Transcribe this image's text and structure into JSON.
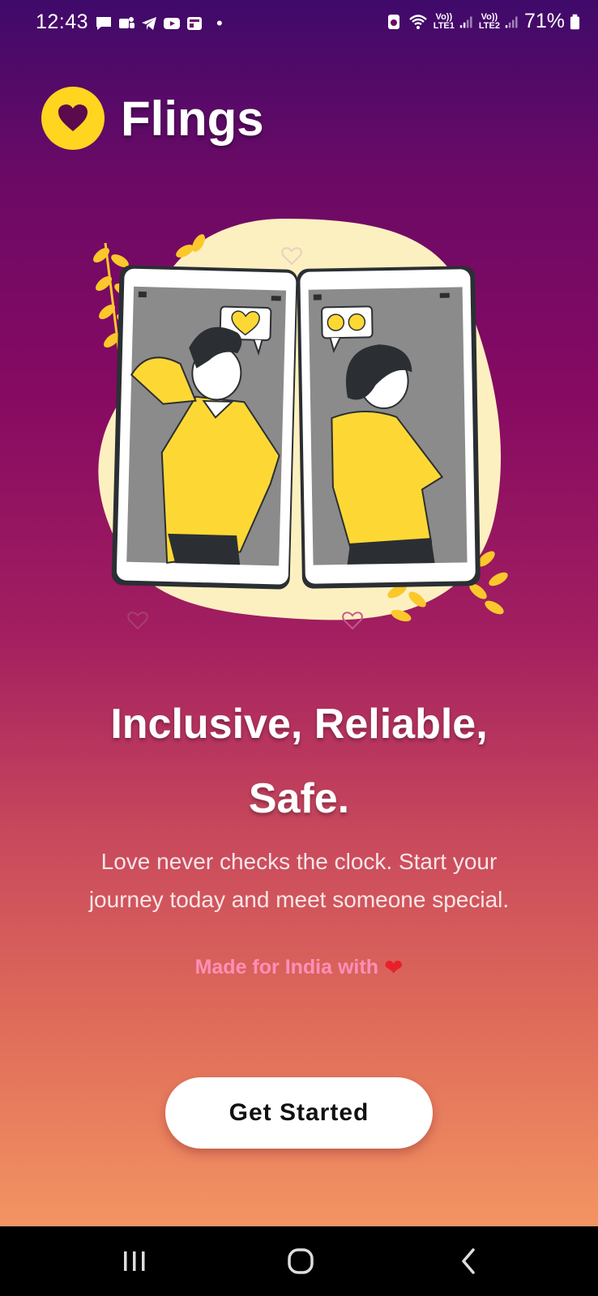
{
  "status_bar": {
    "time": "12:43",
    "notification_icons": [
      "chat-bubble-icon",
      "teams-icon",
      "telegram-icon",
      "youtube-icon",
      "news-icon"
    ],
    "more_dot": "•",
    "sim1_label": "LTE1",
    "sim2_label": "LTE2",
    "volte_label": "Vo))",
    "battery_percent": "71%"
  },
  "brand": {
    "name": "Flings",
    "accent_color": "#ffd51f"
  },
  "illustration": {
    "description_icons": [
      "heart-bubble-icon",
      "smile-bubble-icon"
    ]
  },
  "headline": {
    "line1": "Inclusive, Reliable,",
    "line2": "Safe."
  },
  "subtitle": {
    "line1": "Love never checks the clock. Start your",
    "line2": "journey today and meet someone special."
  },
  "made_for": {
    "text": "Made for India with",
    "heart": "❤"
  },
  "cta": {
    "label": "Get Started"
  },
  "nav": {
    "recents": "recents-icon",
    "home": "home-icon",
    "back": "back-icon"
  }
}
